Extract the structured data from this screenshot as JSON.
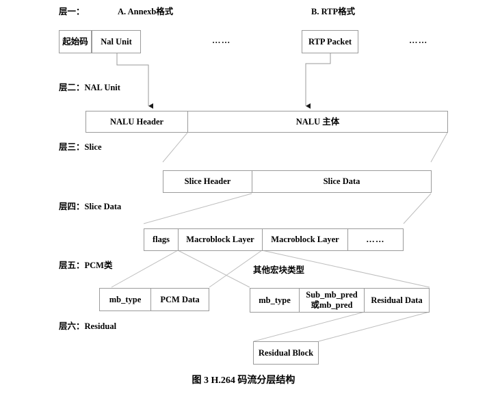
{
  "figure": {
    "caption": "图 3 H.264 码流分层结构"
  },
  "layers": [
    {
      "label": "层一："
    },
    {
      "label": "层二：NAL Unit"
    },
    {
      "label": "层三：Slice"
    },
    {
      "label": "层四：Slice Data"
    },
    {
      "label": "层五：PCM类"
    },
    {
      "label": "层六：Residual"
    }
  ],
  "headings": {
    "format_a": "A. Annexb格式",
    "format_b": "B. RTP格式",
    "other_mb_types": "其他宏块类型"
  },
  "ellipsis": {
    "a": "……",
    "b": "……",
    "mb": "……"
  },
  "boxes": {
    "start_code": "起始码",
    "nal_unit": "Nal Unit",
    "rtp_packet": "RTP Packet",
    "nalu_header": "NALU Header",
    "nalu_body": "NALU 主体",
    "slice_header": "Slice Header",
    "slice_data": "Slice Data",
    "flags": "flags",
    "macroblock_layer_1": "Macroblock Layer",
    "macroblock_layer_2": "Macroblock Layer",
    "pcm_mb_type": "mb_type",
    "pcm_data": "PCM Data",
    "other_mb_type": "mb_type",
    "sub_mb_pred": "Sub_mb_pred\n或mb_pred",
    "residual_data": "Residual Data",
    "residual_block": "Residual Block"
  },
  "colors": {
    "border": "#9a9a9a",
    "connector": "#b0b0b0",
    "arrow": "#808080",
    "text": "#000000",
    "background": "#ffffff"
  }
}
